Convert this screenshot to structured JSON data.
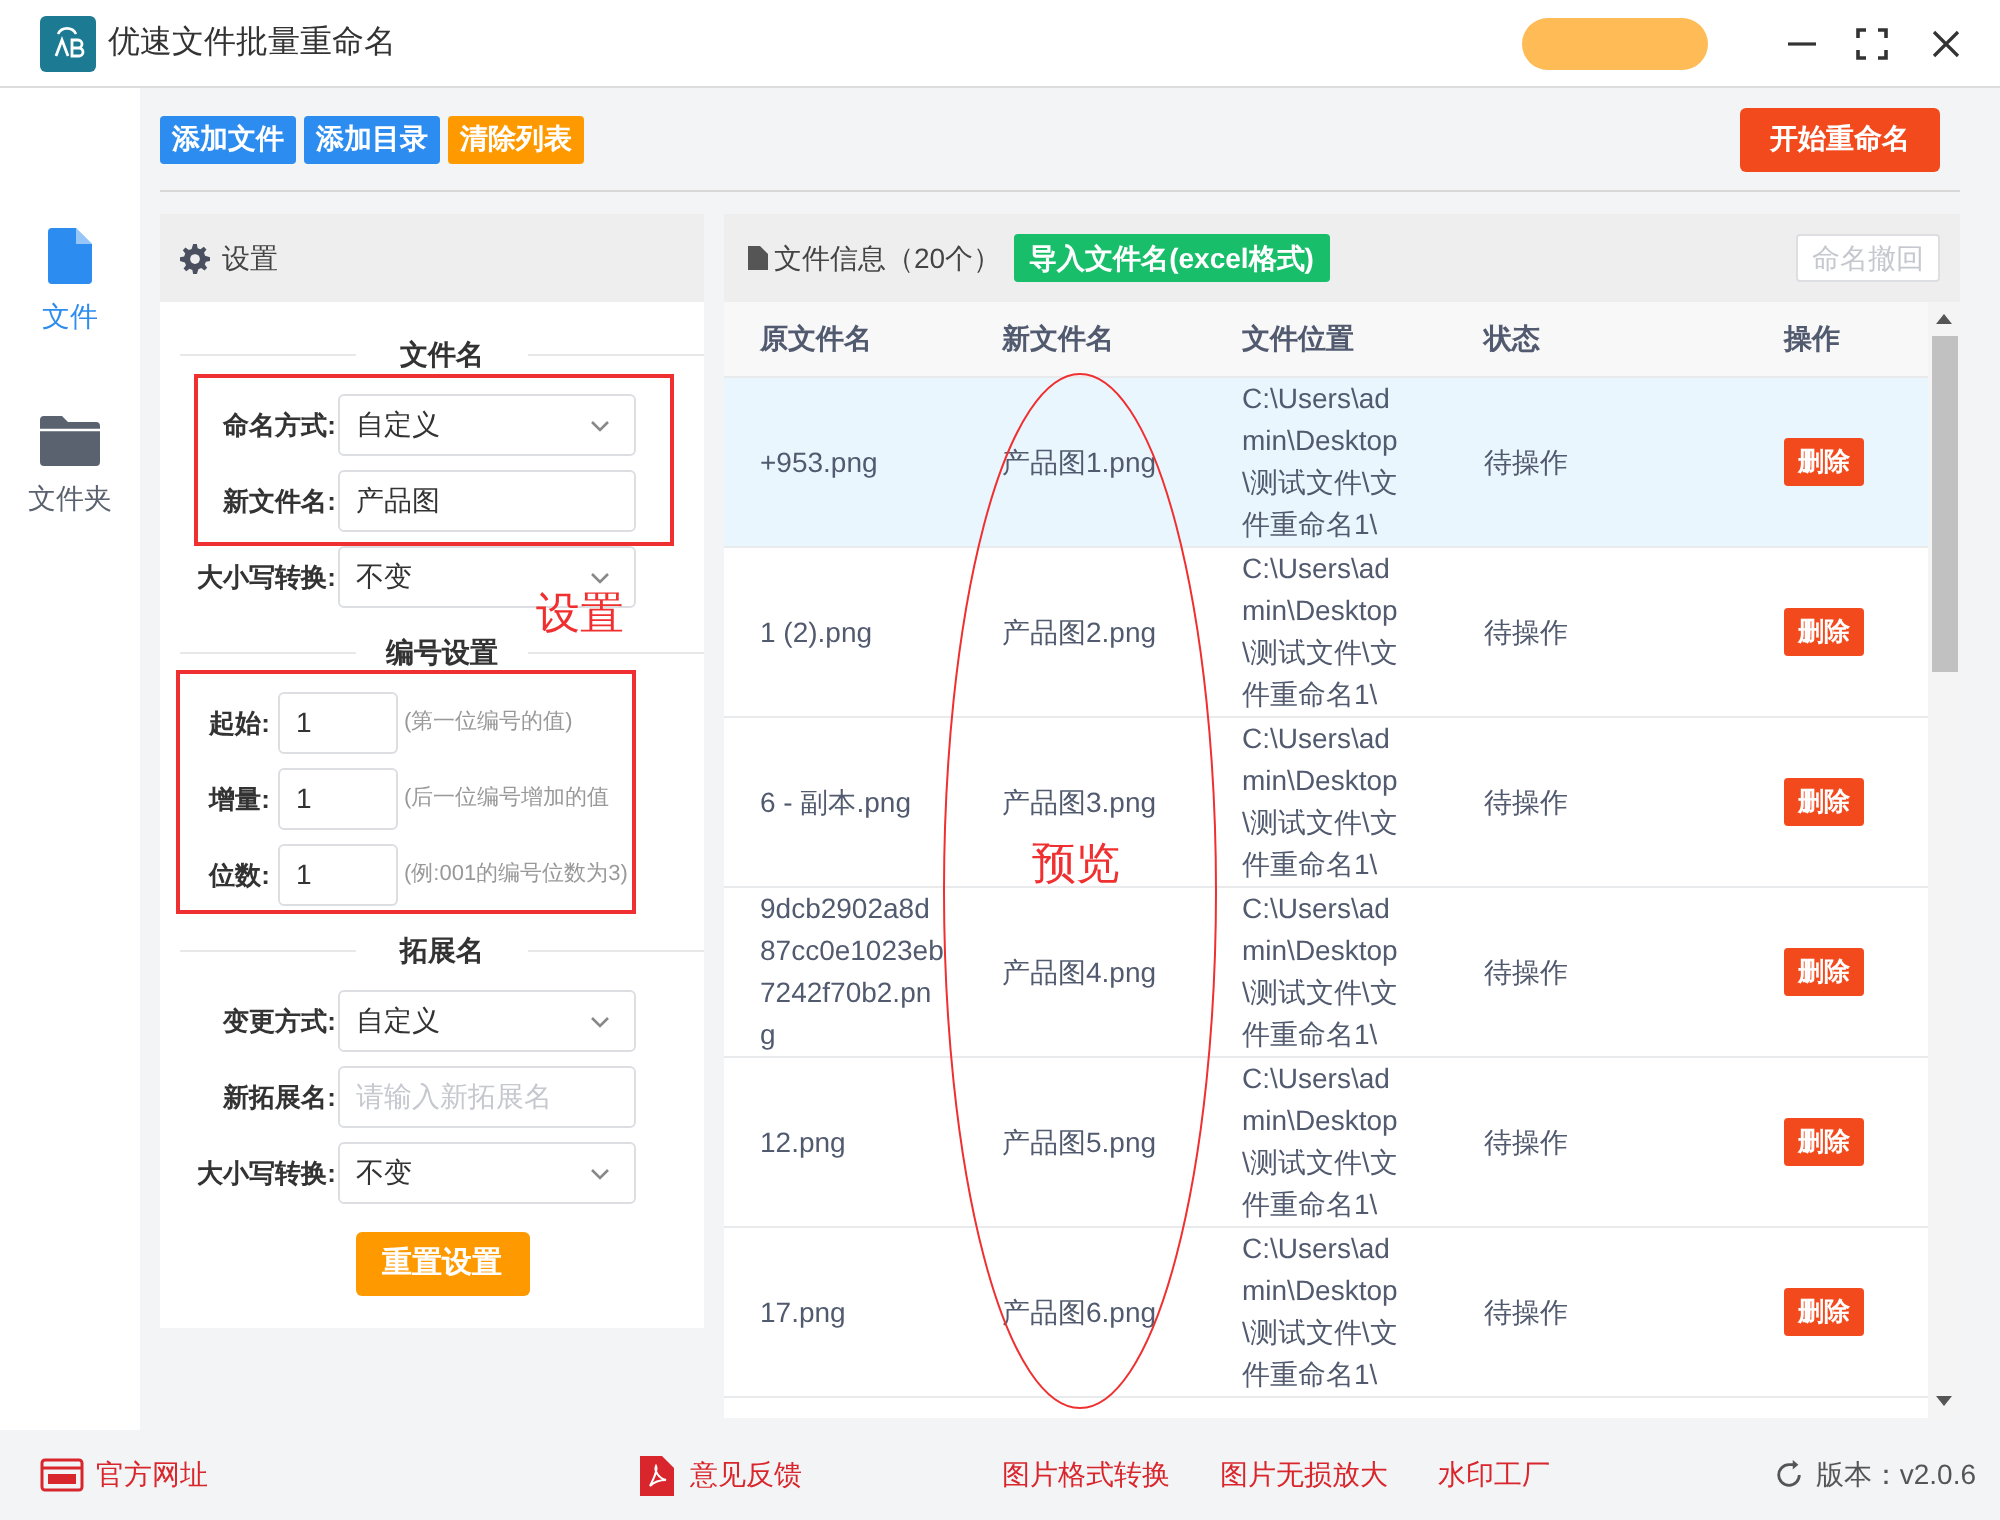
{
  "window": {
    "title": "优速文件批量重命名"
  },
  "toolbar": {
    "buttons": [
      {
        "label": "添加文件",
        "kind": "blue"
      },
      {
        "label": "添加目录",
        "kind": "blue"
      },
      {
        "label": "清除列表",
        "kind": "orange"
      }
    ],
    "start_button": "开始重命名"
  },
  "sidebar": {
    "items": [
      {
        "label": "文件",
        "kind": "file",
        "selected": true
      },
      {
        "label": "文件夹",
        "kind": "folder",
        "selected": false
      }
    ]
  },
  "settings": {
    "title": "设置",
    "sections": [
      {
        "title": "文件名",
        "fields": [
          {
            "kind": "select",
            "label": "命名方式:",
            "value": "自定义"
          },
          {
            "kind": "input",
            "label": "新文件名:",
            "value": "产品图"
          },
          {
            "kind": "select",
            "label": "大小写转换:",
            "value": "不变"
          }
        ]
      },
      {
        "title": "编号设置",
        "fields": [
          {
            "kind": "number",
            "label": "起始:",
            "value": "1",
            "hint": "(第一位编号的值)"
          },
          {
            "kind": "number",
            "label": "增量:",
            "value": "1",
            "hint": "(后一位编号增加的值"
          },
          {
            "kind": "number",
            "label": "位数:",
            "value": "1",
            "hint": "(例:001的编号位数为3)"
          }
        ]
      },
      {
        "title": "拓展名",
        "fields": [
          {
            "kind": "select",
            "label": "变更方式:",
            "value": "自定义"
          },
          {
            "kind": "input",
            "label": "新拓展名:",
            "placeholder": "请输入新拓展名"
          },
          {
            "kind": "select",
            "label": "大小写转换:",
            "value": "不变"
          }
        ]
      }
    ],
    "reset_button": "重置设置"
  },
  "file_panel": {
    "title": "文件信息（20个）",
    "import_button": "导入文件名(excel格式)",
    "undo_button": "命名撤回",
    "columns": [
      "原文件名",
      "新文件名",
      "文件位置",
      "状态",
      "操作"
    ],
    "rows": [
      {
        "selected": true,
        "original": "+953.png",
        "new": "产品图1.png",
        "location": "C:\\Users\\admin\\Desktop\\测试文件\\文件重命名1\\",
        "status": "待操作",
        "action": "删除"
      },
      {
        "selected": false,
        "original": "1 (2).png",
        "new": "产品图2.png",
        "location": "C:\\Users\\admin\\Desktop\\测试文件\\文件重命名1\\",
        "status": "待操作",
        "action": "删除"
      },
      {
        "selected": false,
        "original": "6 - 副本.png",
        "new": "产品图3.png",
        "location": "C:\\Users\\admin\\Desktop\\测试文件\\文件重命名1\\",
        "status": "待操作",
        "action": "删除"
      },
      {
        "selected": false,
        "original": "9dcb2902a8d87cc0e1023eb7242f70b2.png",
        "new": "产品图4.png",
        "location": "C:\\Users\\admin\\Desktop\\测试文件\\文件重命名1\\",
        "status": "待操作",
        "action": "删除"
      },
      {
        "selected": false,
        "original": "12.png",
        "new": "产品图5.png",
        "location": "C:\\Users\\admin\\Desktop\\测试文件\\文件重命名1\\",
        "status": "待操作",
        "action": "删除"
      },
      {
        "selected": false,
        "original": "17.png",
        "new": "产品图6.png",
        "location": "C:\\Users\\admin\\Desktop\\测试文件\\文件重命名1\\",
        "status": "待操作",
        "action": "删除"
      }
    ]
  },
  "annotations": {
    "settings_label": "设置",
    "preview_label": "预览"
  },
  "status_bar": {
    "links": [
      {
        "kind": "web",
        "label": "官方网址"
      },
      {
        "kind": "pdf",
        "label": "意见反馈"
      },
      {
        "kind": "plain",
        "label": "图片格式转换"
      },
      {
        "kind": "plain",
        "label": "图片无损放大"
      },
      {
        "kind": "plain",
        "label": "水印工厂"
      }
    ],
    "version": "版本：v2.0.6"
  }
}
